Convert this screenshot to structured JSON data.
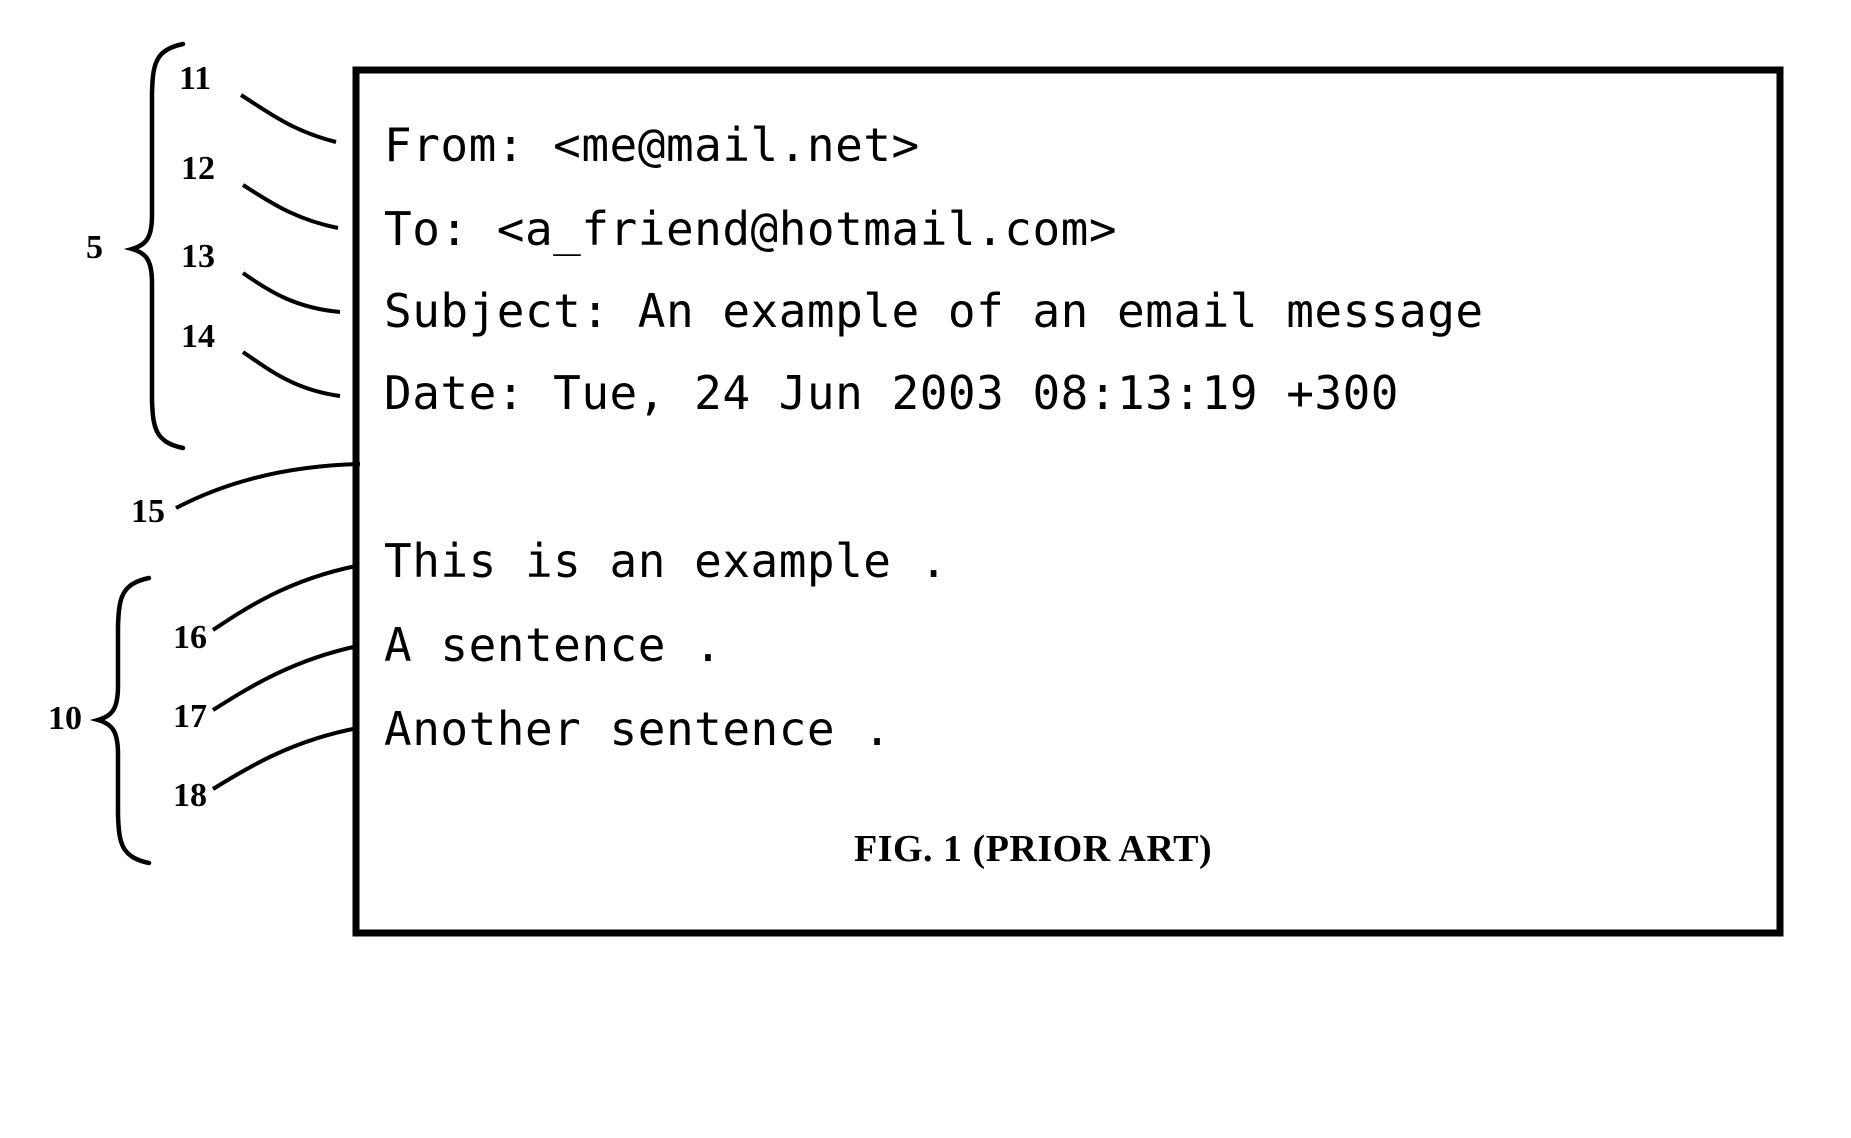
{
  "figure": {
    "caption": "FIG. 1 (PRIOR ART)",
    "title": "FIG. 1 (PRIOR ART)"
  },
  "email": {
    "headers": [
      {
        "ref": "11",
        "text": "From: <me@mail.net>"
      },
      {
        "ref": "12",
        "text": "To: <a_friend@hotmail.com>"
      },
      {
        "ref": "13",
        "text": "Subject: An example of an email message"
      },
      {
        "ref": "14",
        "text": "Date: Tue, 24 Jun 2003 08:13:19 +300"
      }
    ],
    "body": [
      {
        "ref": "16",
        "text": "This is an example ."
      },
      {
        "ref": "17",
        "text": "A sentence ."
      },
      {
        "ref": "18",
        "text": "Another sentence ."
      }
    ]
  },
  "reference_numerals": {
    "header_group": "5",
    "body_group": "10",
    "from_line": "11",
    "to_line": "12",
    "subject_line": "13",
    "date_line": "14",
    "body_start": "15",
    "body_line_1": "16",
    "body_line_2": "17",
    "body_line_3": "18"
  },
  "colors": {
    "ink": "#000000",
    "paper": "#ffffff"
  }
}
